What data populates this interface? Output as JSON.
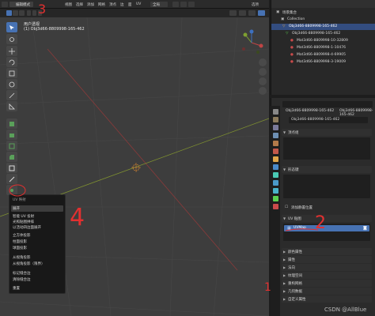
{
  "header": {
    "mode": "编辑模式",
    "menus": [
      "视图",
      "选择",
      "添加",
      "网格",
      "顶点",
      "边",
      "面",
      "UV"
    ],
    "global": "全局",
    "overlay_label": "选项"
  },
  "viewport": {
    "view_name": "用户透视",
    "object_label": "(1) Obj3d66-8809998-165-462",
    "transparent_label": "透视"
  },
  "uv_menu": {
    "title": "UV 映射",
    "items": [
      "展开",
      "智能 UV 投射",
      "光照贴图拼排",
      "以活动四边面展开",
      "立方体投影",
      "柱面投影",
      "球面投影",
      "从视角投影",
      "从视角投影（限界）",
      "标记缝合边",
      "清除缝合边",
      "重置"
    ]
  },
  "outliner": {
    "title": "场景集合",
    "collection": "Collection",
    "object": "Obj3d66-8809998-165-462",
    "mesh": "Obj3d66-8809998-165-462",
    "materials": [
      "Mat3d66-8809998-10-32809",
      "Mat3d66-8809998-1-10476",
      "Mat3d66-8809998-4-69905",
      "Mat3d66-8809998-3-19009"
    ]
  },
  "properties": {
    "breadcrumb_object": "Obj3d66-8809998-165-462",
    "breadcrumb_mesh": "Obj3d66-8809998-165-462",
    "mesh_name": "Obj3d66-8809998-165-462",
    "sections": {
      "vertex_groups": "顶点组",
      "shape_keys": "形态键",
      "uv_maps": "UV 贴图",
      "add_rest": "添加静置位置",
      "vertex_colors": "颜色属性",
      "attributes": "属性",
      "normals": "法向",
      "texture_space": "纹理空间",
      "remesh": "重构网格",
      "geometry_data": "几何数据",
      "custom_props": "自定义属性"
    },
    "uv_map_name": "UVMap"
  },
  "annotations": {
    "num3": "3",
    "num4": "4",
    "num2": "2",
    "num1": "1"
  },
  "watermark": "CSDN @AllBlue"
}
